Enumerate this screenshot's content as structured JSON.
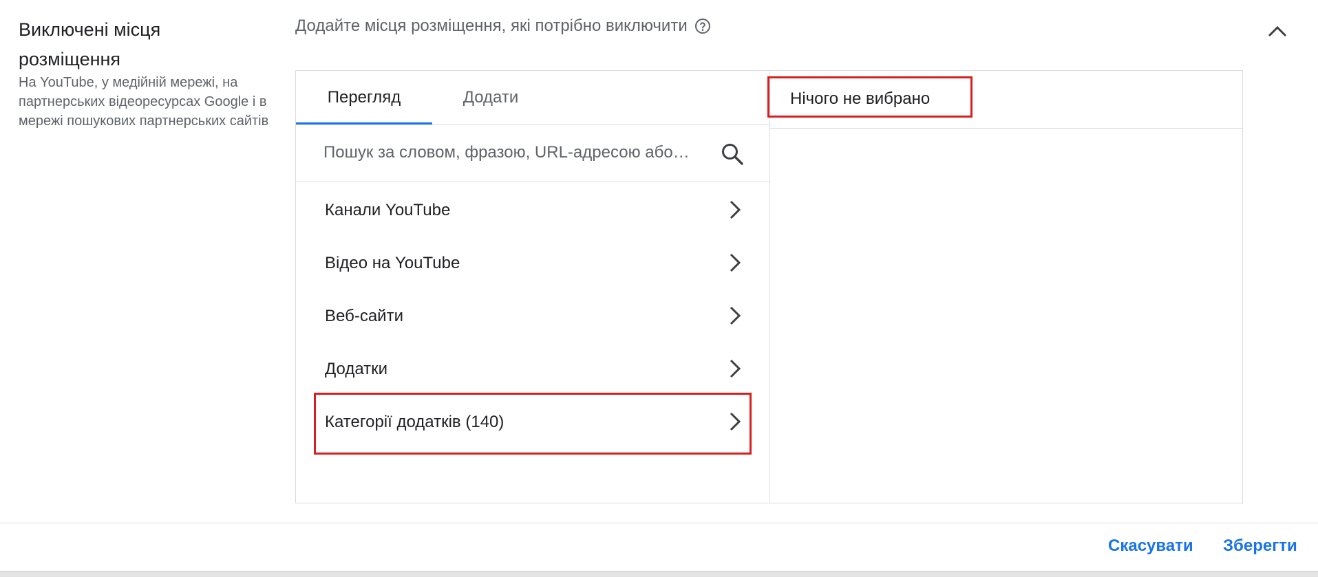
{
  "section": {
    "title": "Виключені місця розміщення",
    "description": "На YouTube, у медійній мережі, на партнерських відеоресурсах Google і в мережі пошукових партнерських сайтів"
  },
  "header": {
    "prompt": "Додайте місця розміщення, які потрібно виключити",
    "help_icon": "help-circle-icon",
    "collapse_icon": "chevron-up-icon"
  },
  "tabs": [
    {
      "label": "Перегляд",
      "active": true
    },
    {
      "label": "Додати",
      "active": false
    }
  ],
  "search": {
    "placeholder": "Пошук за словом, фразою, URL-адресою або…",
    "icon": "search-icon"
  },
  "list": [
    {
      "label": "Канали YouTube"
    },
    {
      "label": "Відео на YouTube"
    },
    {
      "label": "Веб-сайти"
    },
    {
      "label": "Додатки"
    },
    {
      "label": "Категорії додатків (140)"
    }
  ],
  "selected": {
    "empty_text": "Нічого не вибрано"
  },
  "footer": {
    "cancel_label": "Скасувати",
    "save_label": "Зберегти"
  },
  "colors": {
    "accent": "#1a73e8",
    "highlight": "#d81e1e",
    "border": "#dadce0",
    "muted_text": "#5f6368"
  }
}
